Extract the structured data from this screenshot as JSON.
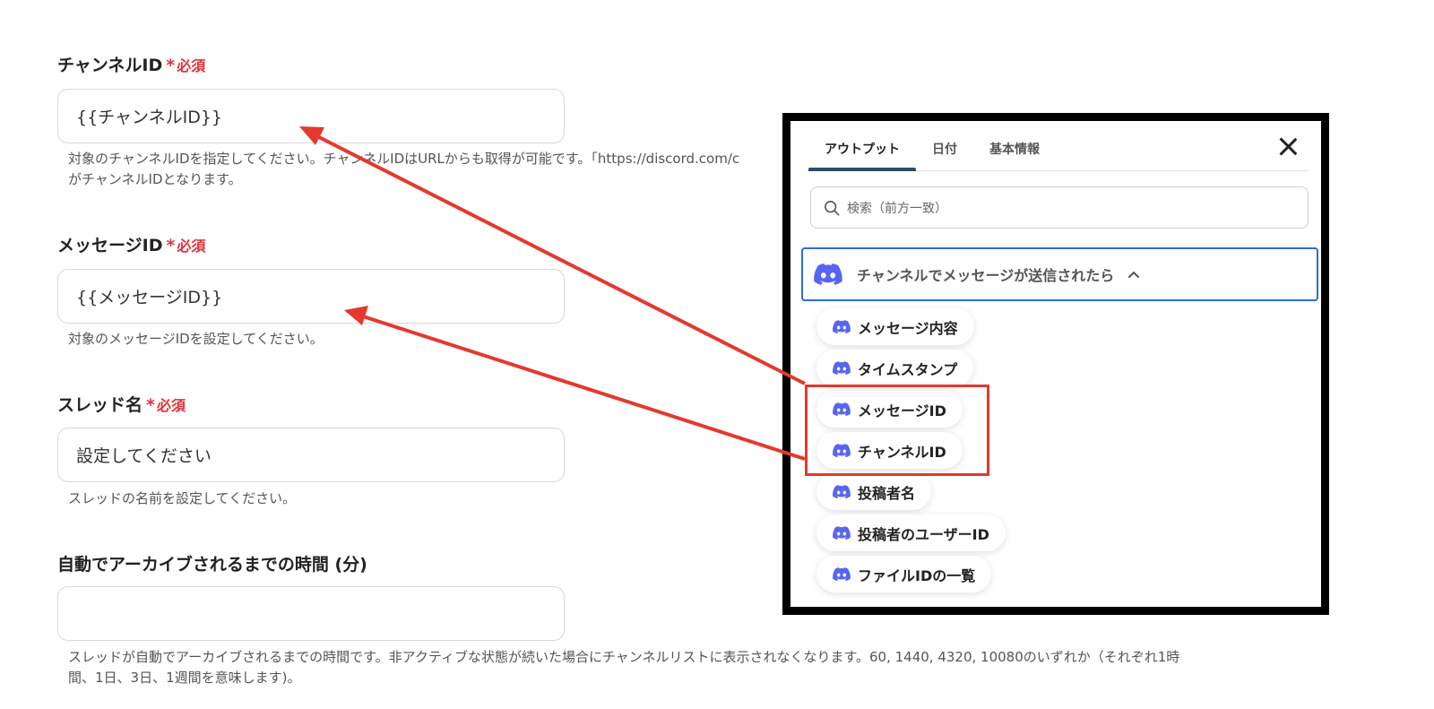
{
  "form": {
    "required_mark": "*",
    "required_text": "必須",
    "channel_id": {
      "label": "チャンネルID",
      "value": "{{チャンネルID}}",
      "help_line1": "対象のチャンネルIDを指定してください。チャンネルIDはURLからも取得が可能です。「https://discord.com/c",
      "help_line2": "がチャンネルIDとなります。"
    },
    "message_id": {
      "label": "メッセージID",
      "value": "{{メッセージID}}",
      "help": "対象のメッセージIDを設定してください。"
    },
    "thread_name": {
      "label": "スレッド名",
      "value": "設定してください",
      "help": "スレッドの名前を設定してください。"
    },
    "archive_time": {
      "label": "自動でアーカイブされるまでの時間 (分)",
      "value": "",
      "help_line1": "スレッドが自動でアーカイブされるまでの時間です。非アクティブな状態が続いた場合にチャンネルリストに表示されなくなります。60, 1440, 4320, 10080のいずれか（それぞれ1時",
      "help_line2": "間、1日、3日、1週間を意味します)。"
    }
  },
  "panel": {
    "tabs": [
      "アウトプット",
      "日付",
      "基本情報"
    ],
    "active_tab": "アウトプット",
    "search_placeholder": "検索（前方一致）",
    "group_title": "チャンネルでメッセージが送信されたら",
    "group_icon": "discord-icon",
    "items": [
      "メッセージ内容",
      "タイムスタンプ",
      "メッセージID",
      "チャンネルID",
      "投稿者名",
      "投稿者のユーザーID",
      "ファイルIDの一覧"
    ]
  },
  "colors": {
    "required": "#e0323c",
    "discord": "#5865F2",
    "active_tab": "#2d4a66",
    "group_border": "#2c6cd6",
    "annotation": "#e3392f"
  }
}
